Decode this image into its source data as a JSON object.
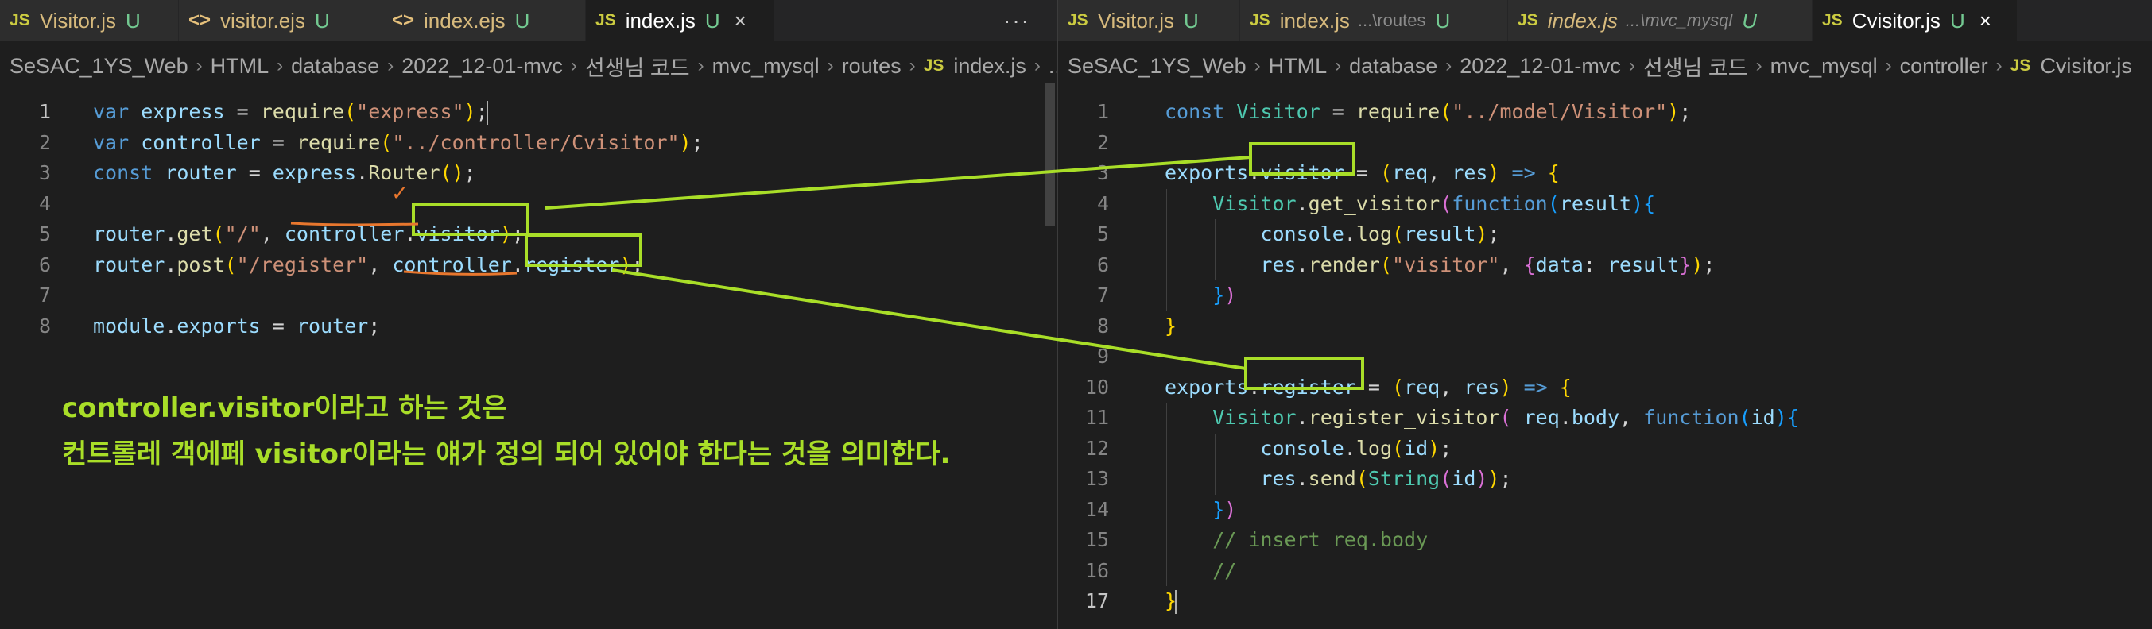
{
  "left_pane": {
    "tabs": [
      {
        "icon": "JS",
        "name": "Visitor.js",
        "badge": "U",
        "active": false
      },
      {
        "icon": "<>",
        "name": "visitor.ejs",
        "badge": "U",
        "active": false
      },
      {
        "icon": "<>",
        "name": "index.ejs",
        "badge": "U",
        "active": false
      },
      {
        "icon": "JS",
        "name": "index.js",
        "badge": "U",
        "close": "×",
        "active": true
      }
    ],
    "more_actions": "···",
    "breadcrumb": [
      "SeSAC_1YS_Web",
      "HTML",
      "database",
      "2022_12-01-mvc",
      "선생님 코드",
      "mvc_mysql",
      "routes"
    ],
    "breadcrumb_file_icon": "JS",
    "breadcrumb_file": "index.js",
    "breadcrumb_tail": "...",
    "line_numbers": [
      "1",
      "2",
      "3",
      "4",
      "5",
      "6",
      "7",
      "8"
    ],
    "current_line": 1
  },
  "right_pane": {
    "tabs": [
      {
        "icon": "JS",
        "name": "Visitor.js",
        "desc": "",
        "badge": "U",
        "active": false
      },
      {
        "icon": "JS",
        "name": "index.js",
        "desc": "...\\routes",
        "badge": "U",
        "active": false
      },
      {
        "icon": "JS",
        "name": "index.js",
        "desc": "...\\mvc_mysql",
        "badge": "U",
        "active": false,
        "italic": true
      },
      {
        "icon": "JS",
        "name": "Cvisitor.js",
        "desc": "",
        "badge": "U",
        "close": "×",
        "active": true
      }
    ],
    "breadcrumb": [
      "SeSAC_1YS_Web",
      "HTML",
      "database",
      "2022_12-01-mvc",
      "선생님 코드",
      "mvc_mysql",
      "controller"
    ],
    "breadcrumb_file_icon": "JS",
    "breadcrumb_file": "Cvisitor.js",
    "line_numbers": [
      "1",
      "2",
      "3",
      "4",
      "5",
      "6",
      "7",
      "8",
      "9",
      "10",
      "11",
      "12",
      "13",
      "14",
      "15",
      "16",
      "17"
    ],
    "current_line": 17
  },
  "annotation": {
    "line1": "controller.visitor이라고 하는 것은",
    "line2": "컨트롤레 객에페 visitor이라는 얘가 정의 되어 있어야 한다는 것을 의미한다.",
    "mark": "✓"
  },
  "colors": {
    "annotation": "#a9de28",
    "underline": "#e8772e",
    "editor_bg": "#1e1e1e",
    "tabbar_bg": "#252526",
    "keyword": "#569cd6",
    "variable": "#9cdcfe",
    "function": "#dcdcaa",
    "string": "#ce9178",
    "comment": "#6a9955"
  },
  "left_code": [
    [
      [
        "var",
        "kw"
      ],
      [
        " ",
        "op"
      ],
      [
        "express",
        "var"
      ],
      [
        " = ",
        "op"
      ],
      [
        "require",
        "fn"
      ],
      [
        "(",
        "p1"
      ],
      [
        "\"express\"",
        "str"
      ],
      [
        ")",
        "p1"
      ],
      [
        ";",
        "op"
      ]
    ],
    [
      [
        "var",
        "kw"
      ],
      [
        " ",
        "op"
      ],
      [
        "controller",
        "var"
      ],
      [
        " = ",
        "op"
      ],
      [
        "require",
        "fn"
      ],
      [
        "(",
        "p1"
      ],
      [
        "\"../controller/Cvisitor\"",
        "str"
      ],
      [
        ")",
        "p1"
      ],
      [
        ";",
        "op"
      ]
    ],
    [
      [
        "const",
        "kw"
      ],
      [
        " ",
        "op"
      ],
      [
        "router",
        "var"
      ],
      [
        " = ",
        "op"
      ],
      [
        "express",
        "var"
      ],
      [
        ".",
        "op"
      ],
      [
        "Router",
        "fn"
      ],
      [
        "()",
        "p1"
      ],
      [
        ";",
        "op"
      ]
    ],
    [],
    [
      [
        "router",
        "var"
      ],
      [
        ".",
        "op"
      ],
      [
        "get",
        "fn"
      ],
      [
        "(",
        "p1"
      ],
      [
        "\"/\"",
        "str"
      ],
      [
        ", ",
        "op"
      ],
      [
        "controller",
        "var"
      ],
      [
        ".",
        "op"
      ],
      [
        "visitor",
        "var"
      ],
      [
        ")",
        "p1"
      ],
      [
        ";",
        "op"
      ]
    ],
    [
      [
        "router",
        "var"
      ],
      [
        ".",
        "op"
      ],
      [
        "post",
        "fn"
      ],
      [
        "(",
        "p1"
      ],
      [
        "\"/register\"",
        "str"
      ],
      [
        ", ",
        "op"
      ],
      [
        "controller",
        "var"
      ],
      [
        ".",
        "op"
      ],
      [
        "register",
        "var"
      ],
      [
        ")",
        "p1"
      ],
      [
        ";",
        "op"
      ]
    ],
    [],
    [
      [
        "module",
        "var"
      ],
      [
        ".",
        "op"
      ],
      [
        "exports",
        "var"
      ],
      [
        " = ",
        "op"
      ],
      [
        "router",
        "var"
      ],
      [
        ";",
        "op"
      ]
    ]
  ],
  "right_code": [
    [
      [
        "const",
        "kw"
      ],
      [
        " ",
        "op"
      ],
      [
        "Visitor",
        "cls"
      ],
      [
        " = ",
        "op"
      ],
      [
        "require",
        "fn"
      ],
      [
        "(",
        "p1"
      ],
      [
        "\"../model/Visitor\"",
        "str"
      ],
      [
        ")",
        "p1"
      ],
      [
        ";",
        "op"
      ]
    ],
    [],
    [
      [
        "exports",
        "var"
      ],
      [
        ".",
        "op"
      ],
      [
        "visitor",
        "var"
      ],
      [
        " = ",
        "op"
      ],
      [
        "(",
        "p1"
      ],
      [
        "req",
        "var"
      ],
      [
        ", ",
        "op"
      ],
      [
        "res",
        "var"
      ],
      [
        ")",
        "p1"
      ],
      [
        " ",
        "op"
      ],
      [
        "=>",
        "kw"
      ],
      [
        " ",
        "op"
      ],
      [
        "{",
        "p1"
      ]
    ],
    [
      [
        "    ",
        "op"
      ],
      [
        "Visitor",
        "cls"
      ],
      [
        ".",
        "op"
      ],
      [
        "get_visitor",
        "fn"
      ],
      [
        "(",
        "p2"
      ],
      [
        "function",
        "kw"
      ],
      [
        "(",
        "p3"
      ],
      [
        "result",
        "var"
      ],
      [
        ")",
        "p3"
      ],
      [
        "{",
        "p3"
      ]
    ],
    [
      [
        "        ",
        "op"
      ],
      [
        "console",
        "var"
      ],
      [
        ".",
        "op"
      ],
      [
        "log",
        "fn"
      ],
      [
        "(",
        "p1"
      ],
      [
        "result",
        "var"
      ],
      [
        ")",
        "p1"
      ],
      [
        ";",
        "op"
      ]
    ],
    [
      [
        "        ",
        "op"
      ],
      [
        "res",
        "var"
      ],
      [
        ".",
        "op"
      ],
      [
        "render",
        "fn"
      ],
      [
        "(",
        "p1"
      ],
      [
        "\"visitor\"",
        "str"
      ],
      [
        ", ",
        "op"
      ],
      [
        "{",
        "p2"
      ],
      [
        "data",
        "var"
      ],
      [
        ": ",
        "op"
      ],
      [
        "result",
        "var"
      ],
      [
        "}",
        "p2"
      ],
      [
        ")",
        "p1"
      ],
      [
        ";",
        "op"
      ]
    ],
    [
      [
        "    ",
        "op"
      ],
      [
        "}",
        "p3"
      ],
      [
        ")",
        "p2"
      ]
    ],
    [
      [
        "}",
        "p1"
      ]
    ],
    [],
    [
      [
        "exports",
        "var"
      ],
      [
        ".",
        "op"
      ],
      [
        "register",
        "var"
      ],
      [
        " = ",
        "op"
      ],
      [
        "(",
        "p1"
      ],
      [
        "req",
        "var"
      ],
      [
        ", ",
        "op"
      ],
      [
        "res",
        "var"
      ],
      [
        ")",
        "p1"
      ],
      [
        " ",
        "op"
      ],
      [
        "=>",
        "kw"
      ],
      [
        " ",
        "op"
      ],
      [
        "{",
        "p1"
      ]
    ],
    [
      [
        "    ",
        "op"
      ],
      [
        "Visitor",
        "cls"
      ],
      [
        ".",
        "op"
      ],
      [
        "register_visitor",
        "fn"
      ],
      [
        "(",
        "p2"
      ],
      [
        " ",
        "op"
      ],
      [
        "req",
        "var"
      ],
      [
        ".",
        "op"
      ],
      [
        "body",
        "var"
      ],
      [
        ", ",
        "op"
      ],
      [
        "function",
        "kw"
      ],
      [
        "(",
        "p3"
      ],
      [
        "id",
        "var"
      ],
      [
        ")",
        "p3"
      ],
      [
        "{",
        "p3"
      ]
    ],
    [
      [
        "        ",
        "op"
      ],
      [
        "console",
        "var"
      ],
      [
        ".",
        "op"
      ],
      [
        "log",
        "fn"
      ],
      [
        "(",
        "p1"
      ],
      [
        "id",
        "var"
      ],
      [
        ")",
        "p1"
      ],
      [
        ";",
        "op"
      ]
    ],
    [
      [
        "        ",
        "op"
      ],
      [
        "res",
        "var"
      ],
      [
        ".",
        "op"
      ],
      [
        "send",
        "fn"
      ],
      [
        "(",
        "p1"
      ],
      [
        "String",
        "cls"
      ],
      [
        "(",
        "p2"
      ],
      [
        "id",
        "var"
      ],
      [
        ")",
        "p2"
      ],
      [
        ")",
        "p1"
      ],
      [
        ";",
        "op"
      ]
    ],
    [
      [
        "    ",
        "op"
      ],
      [
        "}",
        "p3"
      ],
      [
        ")",
        "p2"
      ]
    ],
    [
      [
        "    ",
        "op"
      ],
      [
        "// insert req.body",
        "com"
      ]
    ],
    [
      [
        "    ",
        "op"
      ],
      [
        "//",
        "com"
      ]
    ],
    [
      [
        "}",
        "p1"
      ]
    ]
  ]
}
